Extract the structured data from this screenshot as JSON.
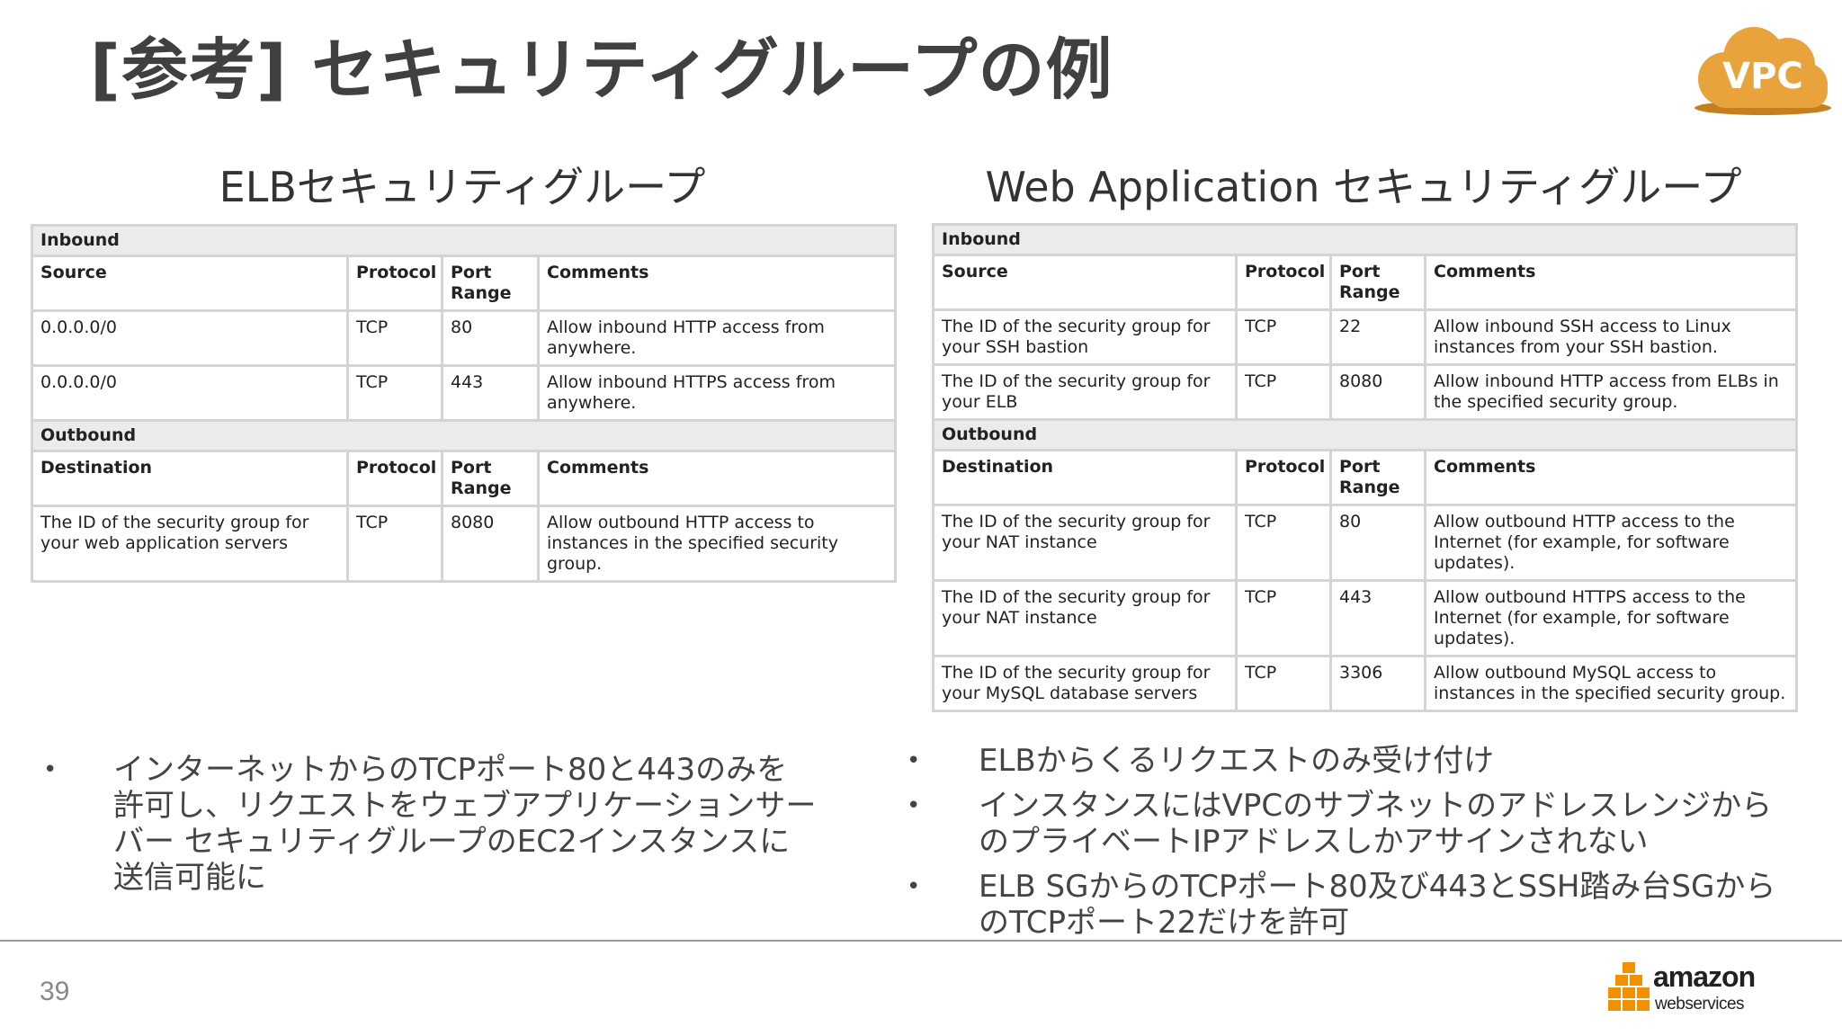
{
  "title": "[参考] セキュリティグループの例",
  "badge": "VPC",
  "elb": {
    "title": "ELBセキュリティグループ",
    "inbound_label": "Inbound",
    "inbound_headers": [
      "Source",
      "Protocol",
      "Port Range",
      "Comments"
    ],
    "inbound_rows": [
      [
        "0.0.0.0/0",
        "TCP",
        "80",
        "Allow inbound HTTP access from anywhere."
      ],
      [
        "0.0.0.0/0",
        "TCP",
        "443",
        "Allow inbound HTTPS access from anywhere."
      ]
    ],
    "outbound_label": "Outbound",
    "outbound_headers": [
      "Destination",
      "Protocol",
      "Port Range",
      "Comments"
    ],
    "outbound_rows": [
      [
        "The ID of the security group for your web application servers",
        "TCP",
        "8080",
        "Allow outbound HTTP access to instances in the specified security group."
      ]
    ]
  },
  "web": {
    "title": "Web Application セキュリティグループ",
    "inbound_label": "Inbound",
    "inbound_headers": [
      "Source",
      "Protocol",
      "Port Range",
      "Comments"
    ],
    "inbound_rows": [
      [
        "The ID of the security group for your SSH bastion",
        "TCP",
        "22",
        "Allow inbound SSH access to Linux instances from your SSH bastion."
      ],
      [
        "The ID of the security group for your ELB",
        "TCP",
        "8080",
        "Allow inbound HTTP access from ELBs in the specified security group."
      ]
    ],
    "outbound_label": "Outbound",
    "outbound_headers": [
      "Destination",
      "Protocol",
      "Port Range",
      "Comments"
    ],
    "outbound_rows": [
      [
        "The ID of the security group for your NAT instance",
        "TCP",
        "80",
        "Allow outbound HTTP access to the Internet (for example, for software updates)."
      ],
      [
        "The ID of the security group for your NAT instance",
        "TCP",
        "443",
        "Allow outbound HTTPS access to the Internet (for example, for software updates)."
      ],
      [
        "The ID of the security group for your MySQL database servers",
        "TCP",
        "3306",
        "Allow outbound MySQL access to instances in the specified security group."
      ]
    ]
  },
  "bullet_marker": "•",
  "left_bullets": [
    "インターネットからのTCPポート80と443のみを許可し、リクエストをウェブアプリケーションサーバー セキュリティグループのEC2インスタンスに送信可能に"
  ],
  "right_bullets": [
    "ELBからくるリクエストのみ受け付け",
    "インスタンスにはVPCのサブネットのアドレスレンジからのプライベートIPアドレスしかアサインされない",
    "ELB SGからのTCPポート80及び443とSSH踏み台SGからのTCPポート22だけを許可"
  ],
  "page_number": "39",
  "footer_logo": {
    "brand": "amazon",
    "sub": "webservices"
  },
  "colors": {
    "title": "#404040",
    "vpc_badge": "#e8a33d",
    "aws_orange": "#f29100",
    "table_border": "#d4d4d4",
    "section_bg": "#ebebeb"
  }
}
